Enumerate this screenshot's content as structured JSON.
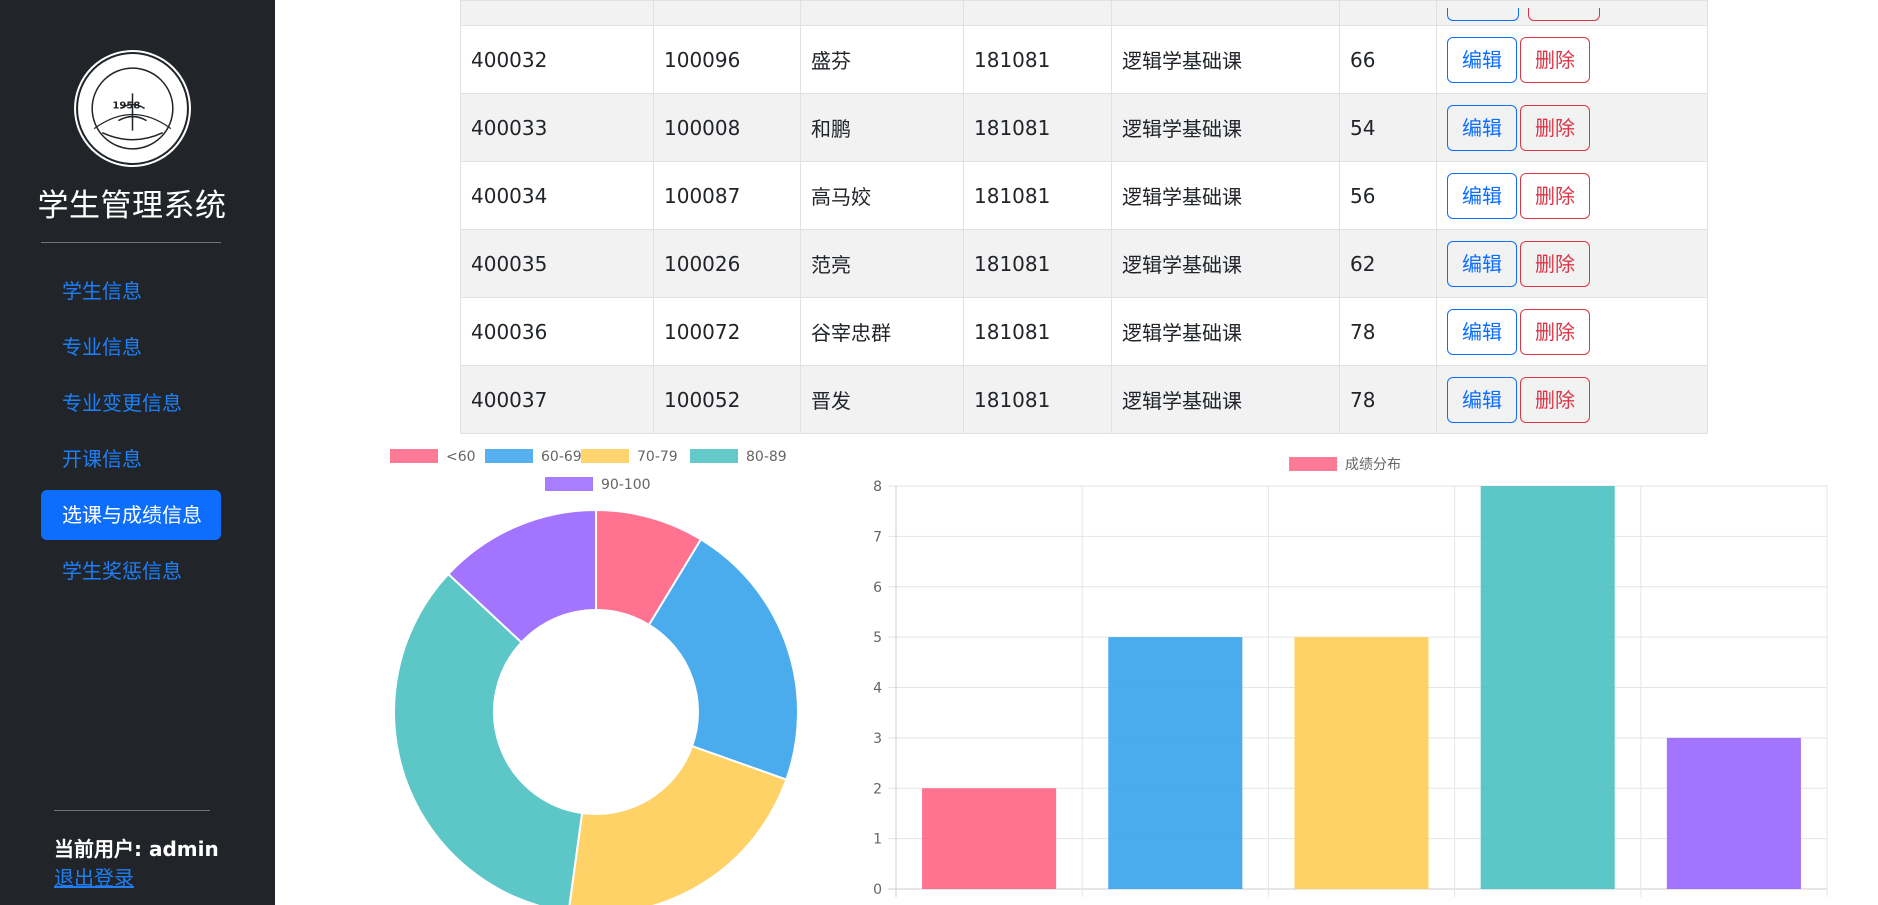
{
  "sidebar": {
    "title": "学生管理系统",
    "logo": {
      "year": "1958",
      "ring_text_top": "中国科学技术大学",
      "ring_text_bottom": "University of Science and Technology of China"
    },
    "nav": [
      {
        "label": "学生信息",
        "active": false
      },
      {
        "label": "专业信息",
        "active": false
      },
      {
        "label": "专业变更信息",
        "active": false
      },
      {
        "label": "开课信息",
        "active": false
      },
      {
        "label": "选课与成绩信息",
        "active": true
      },
      {
        "label": "学生奖惩信息",
        "active": false
      }
    ],
    "current_user": "当前用户: admin",
    "logout": "退出登录"
  },
  "table": {
    "actions": {
      "edit": "编辑",
      "delete": "删除"
    },
    "rows": [
      {
        "id": "400032",
        "student_id": "100096",
        "name": "盛芬",
        "course_id": "181081",
        "course": "逻辑学基础课",
        "score": "66"
      },
      {
        "id": "400033",
        "student_id": "100008",
        "name": "和鹏",
        "course_id": "181081",
        "course": "逻辑学基础课",
        "score": "54"
      },
      {
        "id": "400034",
        "student_id": "100087",
        "name": "高马姣",
        "course_id": "181081",
        "course": "逻辑学基础课",
        "score": "56"
      },
      {
        "id": "400035",
        "student_id": "100026",
        "name": "范亮",
        "course_id": "181081",
        "course": "逻辑学基础课",
        "score": "62"
      },
      {
        "id": "400036",
        "student_id": "100072",
        "name": "谷宰忠群",
        "course_id": "181081",
        "course": "逻辑学基础课",
        "score": "78"
      },
      {
        "id": "400037",
        "student_id": "100052",
        "name": "晋发",
        "course_id": "181081",
        "course": "逻辑学基础课",
        "score": "78"
      }
    ]
  },
  "colors": {
    "sidebar_bg": "#212529",
    "accent": "#0d6efd",
    "danger": "#dc3545",
    "series": [
      "#ff6384",
      "#36a2eb",
      "#ffcd56",
      "#4bc0c0",
      "#9966ff"
    ]
  },
  "chart_data": [
    {
      "type": "pie",
      "variant": "doughnut",
      "labels": [
        "<60",
        "60-69",
        "70-79",
        "80-89",
        "90-100"
      ],
      "values": [
        2,
        5,
        5,
        8,
        3
      ],
      "legend": "top"
    },
    {
      "type": "bar",
      "categories": [
        "<60",
        "60-69",
        "70-79",
        "80-89",
        "90-100"
      ],
      "series": [
        {
          "name": "成绩分布",
          "values": [
            2,
            5,
            5,
            8,
            3
          ]
        }
      ],
      "ylim": [
        0,
        8
      ],
      "yticks": [
        0,
        1,
        2,
        3,
        4,
        5,
        6,
        7,
        8
      ],
      "grid": true,
      "legend": "top"
    }
  ]
}
